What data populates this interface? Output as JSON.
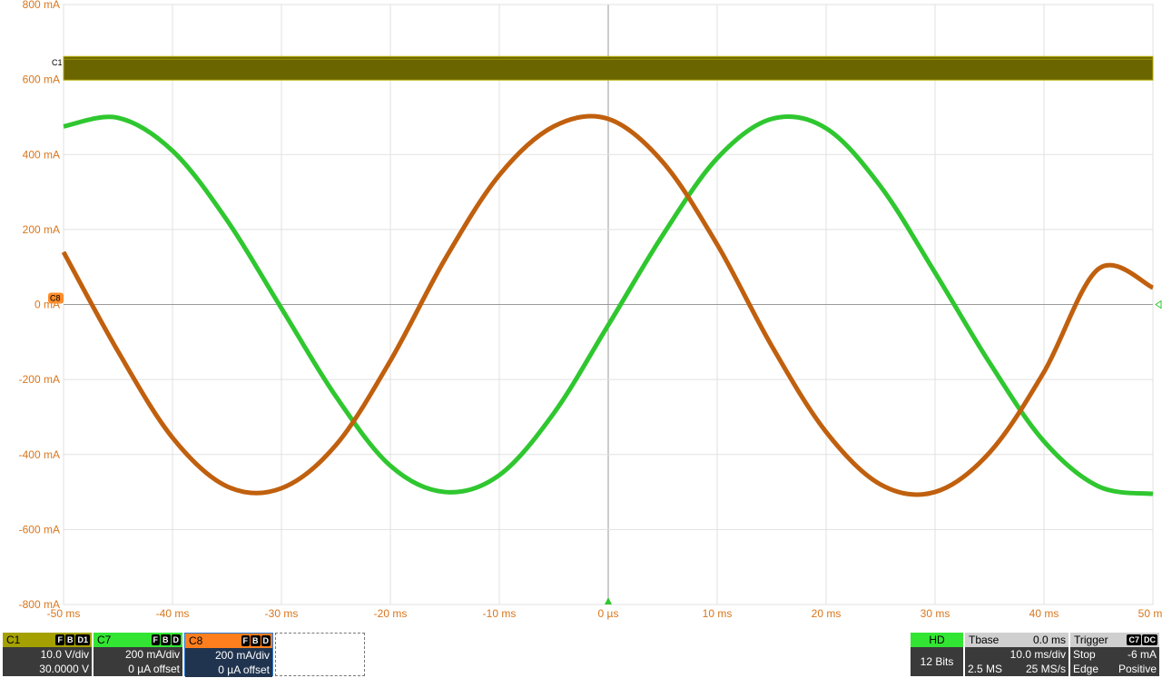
{
  "chart_data": {
    "type": "line",
    "x_unit": "ms",
    "xlim": [
      -50,
      50
    ],
    "ylim": [
      -800,
      800
    ],
    "x_ticks": [
      -50,
      -40,
      -30,
      -20,
      -10,
      0,
      10,
      20,
      30,
      40,
      50
    ],
    "x_tick_labels": [
      "-50 ms",
      "-40 ms",
      "-30 ms",
      "-20 ms",
      "-10 ms",
      "0 µs",
      "10 ms",
      "20 ms",
      "30 ms",
      "40 ms",
      "50 ms"
    ],
    "y_ticks": [
      800,
      600,
      400,
      200,
      0,
      -200,
      -400,
      -600,
      -800
    ],
    "y_tick_labels": [
      "800 mA",
      "600 mA",
      "400 mA",
      "200 mA",
      "0 mA",
      "-200 mA",
      "-400 mA",
      "-600 mA",
      "-800 mA"
    ],
    "grid": true,
    "series": [
      {
        "name": "C7",
        "color": "#2fc72f",
        "x": [
          -50,
          -45,
          -40,
          -35,
          -30,
          -25,
          -20,
          -15,
          -10,
          -5,
          0,
          5,
          10,
          15,
          20,
          25,
          30,
          35,
          40,
          45,
          50
        ],
        "y": [
          475,
          498,
          410,
          225,
          -10,
          -245,
          -430,
          -500,
          -455,
          -290,
          -55,
          185,
          390,
          495,
          470,
          315,
          85,
          -155,
          -365,
          -485,
          -505
        ]
      },
      {
        "name": "C8",
        "color": "#c0600e",
        "x": [
          -50,
          -45,
          -40,
          -35,
          -30,
          -25,
          -20,
          -15,
          -10,
          -5,
          0,
          5,
          10,
          15,
          20,
          25,
          30,
          35,
          40,
          45,
          50
        ],
        "y": [
          140,
          -125,
          -355,
          -485,
          -490,
          -375,
          -150,
          120,
          345,
          475,
          495,
          380,
          160,
          -110,
          -340,
          -480,
          -500,
          -395,
          -180,
          95,
          45
        ]
      },
      {
        "name": "C1",
        "color": "#6b6500",
        "x": [
          -50,
          50
        ],
        "y": [
          630,
          630
        ]
      }
    ]
  },
  "markers": {
    "c1": "C1",
    "c8": "C8"
  },
  "panels": {
    "c1": {
      "label": "C1",
      "badges": [
        "F",
        "B",
        "D1"
      ],
      "scale": "10.0 V/div",
      "offset": "30.0000 V",
      "color": "#a4a000"
    },
    "c7": {
      "label": "C7",
      "badges": [
        "F",
        "B",
        "D"
      ],
      "scale": "200 mA/div",
      "offset": "0 µA offset",
      "color": "#33e533"
    },
    "c8": {
      "label": "C8",
      "badges": [
        "F",
        "B",
        "D"
      ],
      "scale": "200 mA/div",
      "offset": "0 µA offset",
      "color": "#ff7f1e"
    },
    "hd": {
      "label": "HD",
      "bits": "12 Bits"
    },
    "timebase": {
      "label": "Tbase",
      "delay": "0.0 ms",
      "scale": "10.0 ms/div",
      "samples": "2.5 MS",
      "rate": "25 MS/s"
    },
    "trigger": {
      "label": "Trigger",
      "badges": [
        "C7",
        "DC"
      ],
      "mode": "Stop",
      "level": "-6 mA",
      "type": "Edge",
      "slope": "Positive"
    }
  }
}
